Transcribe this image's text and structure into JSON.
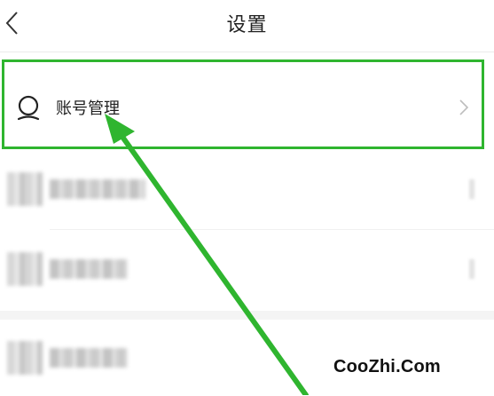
{
  "header": {
    "title": "设置",
    "back_icon": "chevron-left-icon"
  },
  "settings": {
    "account_row": {
      "label": "账号管理",
      "icon": "user-icon",
      "trailing_icon": "chevron-right-icon",
      "highlight_color": "#2fb52f"
    }
  },
  "annotation": {
    "arrow_color": "#2fb52f"
  },
  "watermark": {
    "text": "CooZhi.Com"
  }
}
